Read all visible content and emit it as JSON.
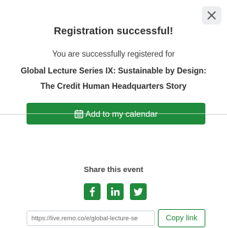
{
  "modal": {
    "close_icon": "close-icon",
    "title": "Registration successful!",
    "subtitle": "You are successfully registered for",
    "event_line_1": "Global Lecture Series IX: Sustainable by Design:",
    "event_line_2": "The Credit Human Headquarters Story",
    "calendar_button": {
      "label": "Add to my calendar",
      "icon": "calendar-icon"
    },
    "share": {
      "label": "Share this event",
      "networks": [
        {
          "name": "facebook",
          "icon": "facebook-icon"
        },
        {
          "name": "linkedin",
          "icon": "linkedin-icon"
        },
        {
          "name": "twitter",
          "icon": "twitter-icon"
        }
      ],
      "link_value": "https://live.remo.co/e/global-lecture-se",
      "copy_label": "Copy link"
    },
    "colors": {
      "accent": "#1f8b3c",
      "title_text": "#2f2f2f",
      "close_bg": "#eceef0"
    }
  }
}
